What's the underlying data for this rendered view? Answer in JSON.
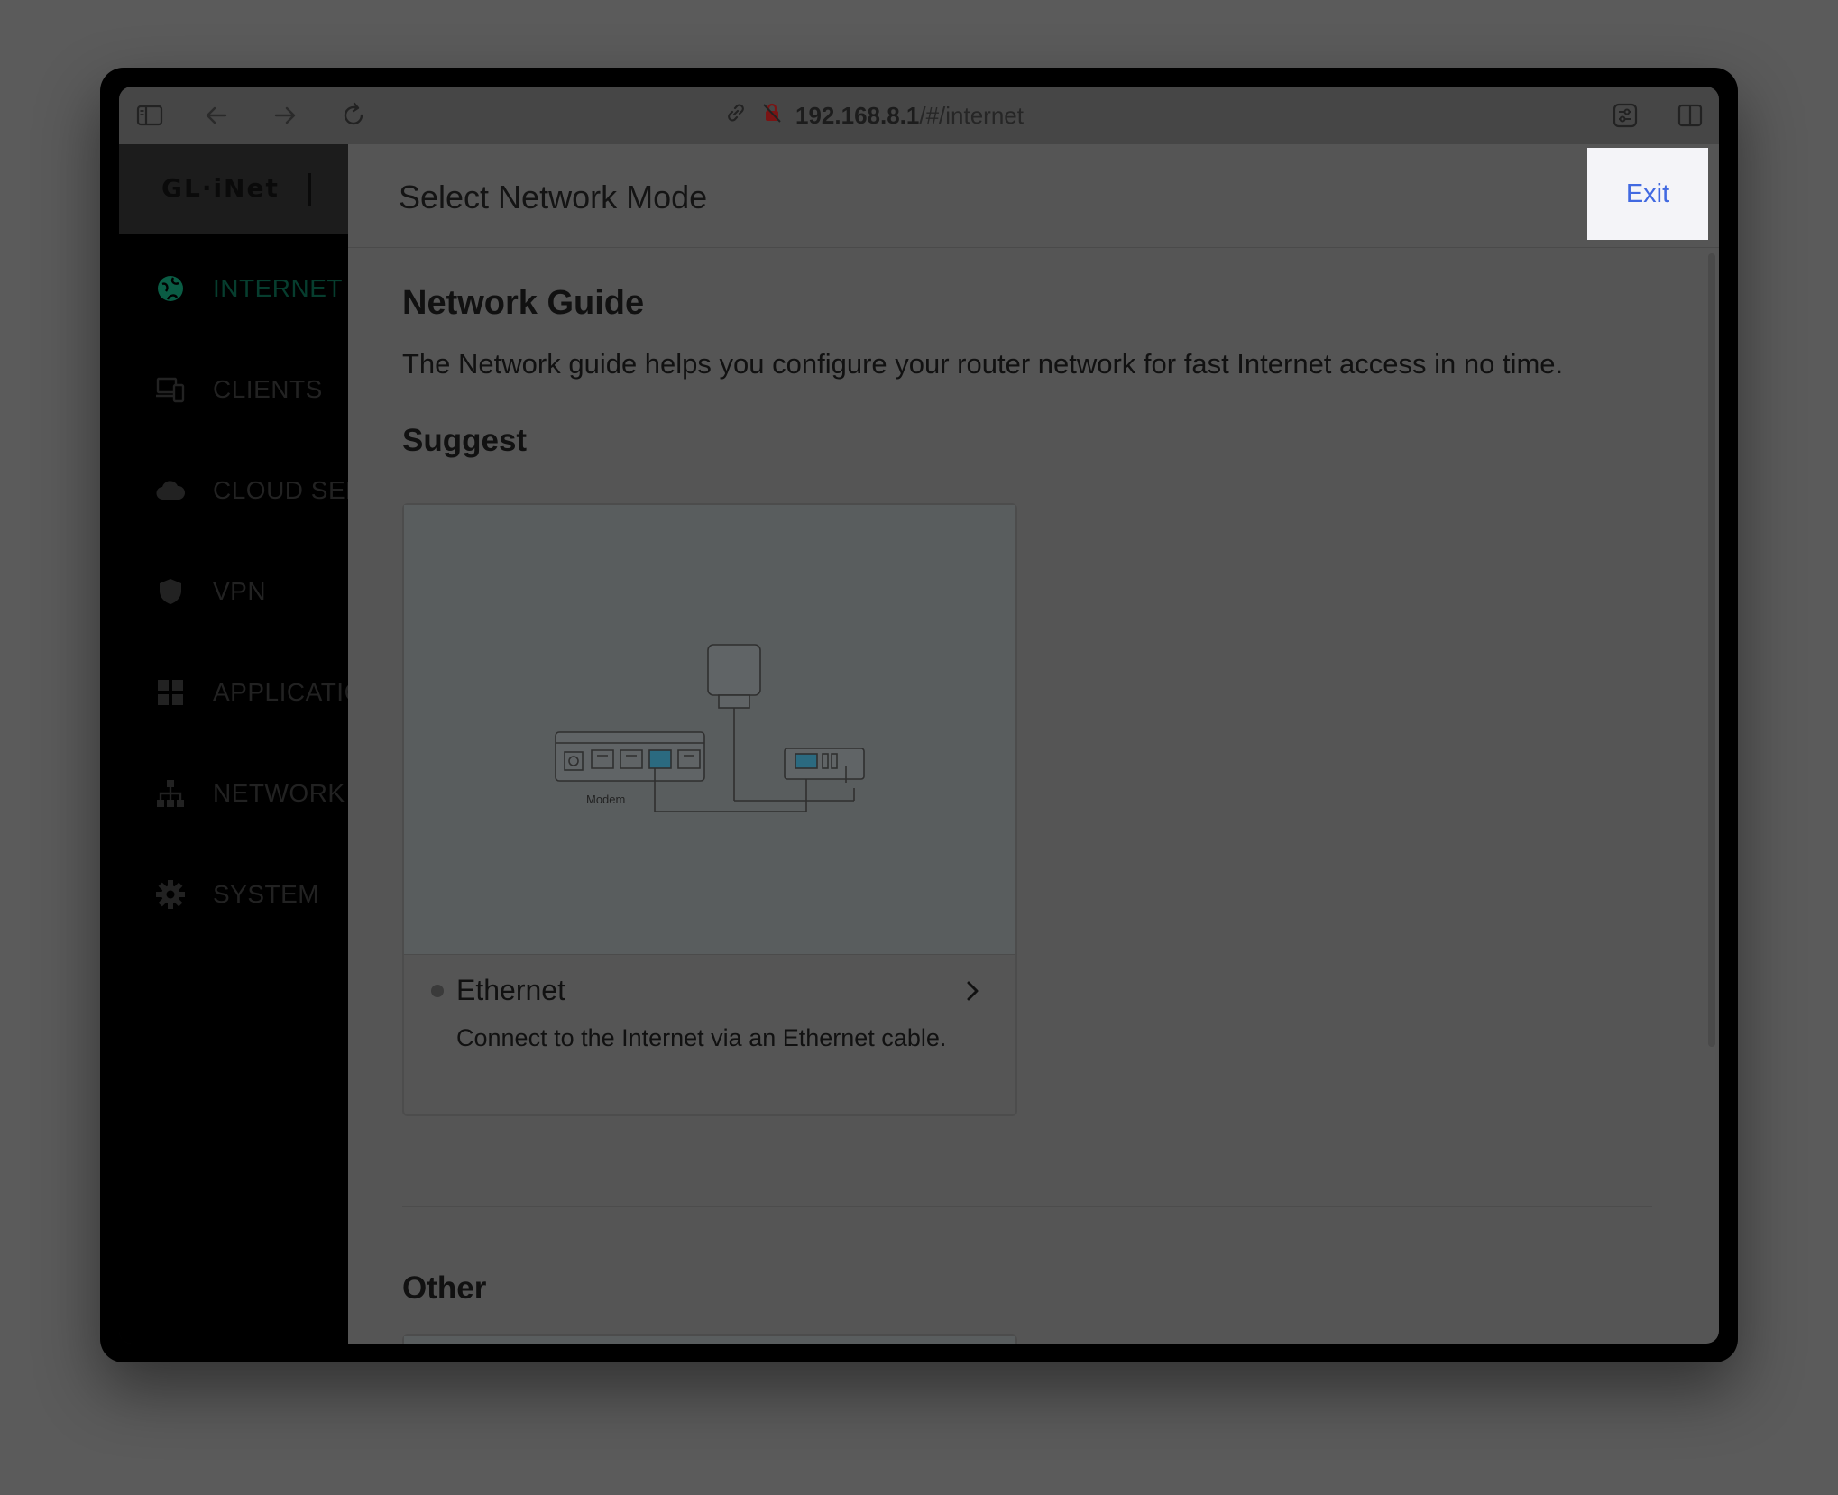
{
  "browser": {
    "url_host": "192.168.8.1",
    "url_path": "/#/internet",
    "icons": [
      "sidebar-toggle-icon",
      "back-arrow-icon",
      "forward-arrow-icon",
      "reload-icon",
      "link-icon",
      "insecure-lock-icon",
      "page-settings-icon",
      "split-view-icon"
    ]
  },
  "sidebar": {
    "logo": "GL·iNet",
    "items": [
      {
        "label": "INTERNET",
        "icon": "globe-icon",
        "active": true
      },
      {
        "label": "CLIENTS",
        "icon": "devices-icon"
      },
      {
        "label": "CLOUD SER",
        "icon": "cloud-icon"
      },
      {
        "label": "VPN",
        "icon": "shield-icon"
      },
      {
        "label": "APPLICATIC",
        "icon": "apps-grid-icon"
      },
      {
        "label": "NETWORK",
        "icon": "network-tree-icon"
      },
      {
        "label": "SYSTEM",
        "icon": "gear-icon"
      }
    ]
  },
  "panel": {
    "title": "Select Network Mode",
    "exit_label": "Exit",
    "guide_heading": "Network Guide",
    "guide_desc": "The Network guide helps you configure your router network for fast Internet access in no time.",
    "suggest_heading": "Suggest",
    "other_heading": "Other",
    "suggest_card": {
      "title": "Ethernet",
      "subtitle": "Connect to the Internet via an Ethernet cable.",
      "illustration_label": "Modem"
    }
  },
  "colors": {
    "accent_green": "#0a5c44",
    "exit_blue": "#4169e1",
    "overlay_bg": "#5b5b5b"
  }
}
